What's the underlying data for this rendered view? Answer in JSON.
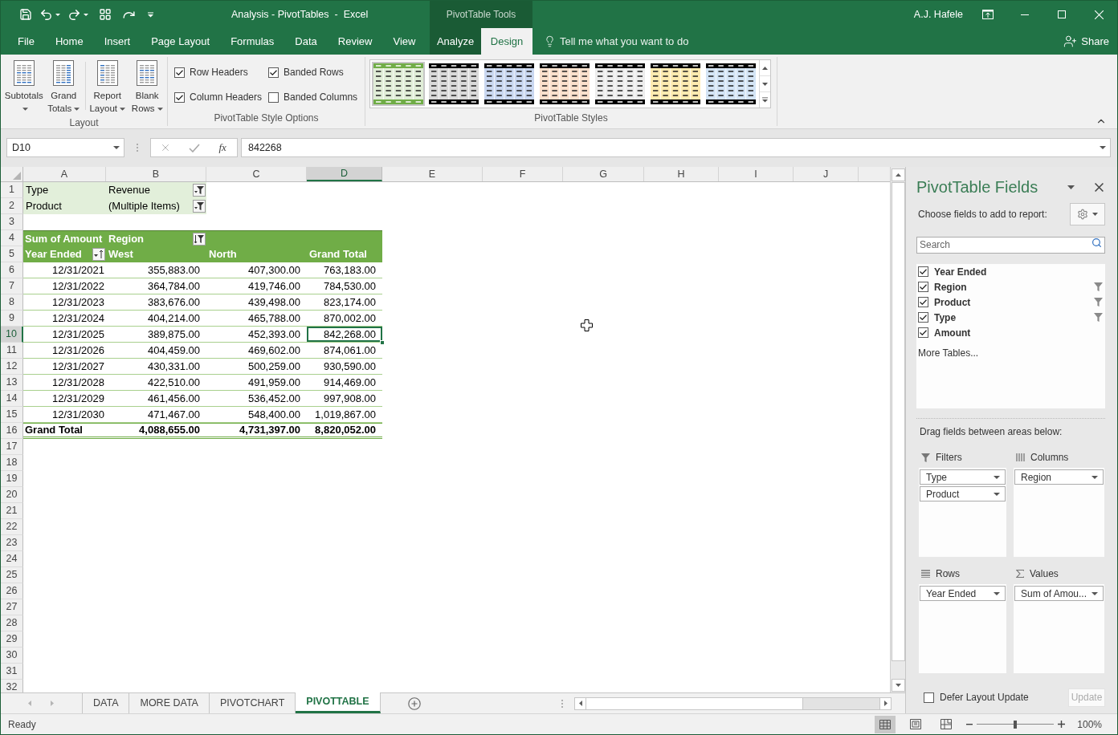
{
  "title_bar": {
    "title": "Analysis - PivotTables  -  Excel",
    "context_group": "PivotTable Tools",
    "user": "A.J. Hafele"
  },
  "ribbon_tabs": [
    {
      "label": "File",
      "kind": "standard",
      "selected": false
    },
    {
      "label": "Home",
      "kind": "standard",
      "selected": false
    },
    {
      "label": "Insert",
      "kind": "standard",
      "selected": false
    },
    {
      "label": "Page Layout",
      "kind": "standard",
      "selected": false
    },
    {
      "label": "Formulas",
      "kind": "standard",
      "selected": false
    },
    {
      "label": "Data",
      "kind": "standard",
      "selected": false
    },
    {
      "label": "Review",
      "kind": "standard",
      "selected": false
    },
    {
      "label": "View",
      "kind": "standard",
      "selected": false
    },
    {
      "label": "Analyze",
      "kind": "contextual",
      "selected": false
    },
    {
      "label": "Design",
      "kind": "contextual",
      "selected": true
    }
  ],
  "tell_me": "Tell me what you want to do",
  "share": "Share",
  "ribbon": {
    "layout": {
      "title": "Layout",
      "buttons": [
        {
          "label": "Subtotals"
        },
        {
          "label": "Grand Totals"
        },
        {
          "label": "Report Layout"
        },
        {
          "label": "Blank Rows"
        }
      ]
    },
    "style_options": {
      "title": "PivotTable Style Options",
      "options": [
        {
          "label": "Row Headers",
          "checked": true
        },
        {
          "label": "Banded Rows",
          "checked": true
        },
        {
          "label": "Column Headers",
          "checked": true
        },
        {
          "label": "Banded Columns",
          "checked": false
        }
      ]
    },
    "styles": {
      "title": "PivotTable Styles",
      "items": [
        {
          "kind": "accent",
          "color": "#70ad47",
          "selected": true
        },
        {
          "kind": "dark",
          "color": "#d9d9d9",
          "selected": false
        },
        {
          "kind": "dark",
          "color": "#c9d7f0",
          "selected": false
        },
        {
          "kind": "dark",
          "color": "#fbe0cc",
          "selected": false
        },
        {
          "kind": "dark",
          "color": "#ededed",
          "selected": false
        },
        {
          "kind": "dark",
          "color": "#ffebb0",
          "selected": false
        },
        {
          "kind": "dark",
          "color": "#d3e4f5",
          "selected": false
        }
      ]
    }
  },
  "formula_bar": {
    "name_box": "D10",
    "function_label": "fx",
    "value": "842268"
  },
  "sheet": {
    "columns": [
      {
        "label": "A",
        "selected": false
      },
      {
        "label": "B",
        "selected": false
      },
      {
        "label": "C",
        "selected": false
      },
      {
        "label": "D",
        "selected": true
      },
      {
        "label": "E",
        "selected": false
      },
      {
        "label": "F",
        "selected": false
      },
      {
        "label": "G",
        "selected": false
      },
      {
        "label": "H",
        "selected": false
      },
      {
        "label": "I",
        "selected": false
      },
      {
        "label": "J",
        "selected": false
      }
    ],
    "rows": [
      {
        "label": "1",
        "selected": false
      },
      {
        "label": "2",
        "selected": false
      },
      {
        "label": "3",
        "selected": false
      },
      {
        "label": "4",
        "selected": false
      },
      {
        "label": "5",
        "selected": false
      },
      {
        "label": "6",
        "selected": false
      },
      {
        "label": "7",
        "selected": false
      },
      {
        "label": "8",
        "selected": false
      },
      {
        "label": "9",
        "selected": false
      },
      {
        "label": "10",
        "selected": true
      },
      {
        "label": "11",
        "selected": false
      },
      {
        "label": "12",
        "selected": false
      },
      {
        "label": "13",
        "selected": false
      },
      {
        "label": "14",
        "selected": false
      },
      {
        "label": "15",
        "selected": false
      },
      {
        "label": "16",
        "selected": false
      },
      {
        "label": "17",
        "selected": false
      },
      {
        "label": "18",
        "selected": false
      },
      {
        "label": "19",
        "selected": false
      },
      {
        "label": "20",
        "selected": false
      },
      {
        "label": "21",
        "selected": false
      },
      {
        "label": "22",
        "selected": false
      },
      {
        "label": "23",
        "selected": false
      },
      {
        "label": "24",
        "selected": false
      },
      {
        "label": "25",
        "selected": false
      },
      {
        "label": "26",
        "selected": false
      },
      {
        "label": "27",
        "selected": false
      },
      {
        "label": "28",
        "selected": false
      },
      {
        "label": "29",
        "selected": false
      },
      {
        "label": "30",
        "selected": false
      },
      {
        "label": "31",
        "selected": false
      },
      {
        "label": "32",
        "selected": false
      }
    ],
    "report_filters": [
      {
        "field": "Type",
        "value": "Revenue"
      },
      {
        "field": "Product",
        "value": "(Multiple Items)"
      }
    ],
    "pivot": {
      "values_label": "Sum of Amount",
      "column_field": "Region",
      "row_field": "Year Ended",
      "column_items": [
        "West",
        "North",
        "Grand Total"
      ],
      "rows": [
        {
          "label": "12/31/2021",
          "cells": [
            {
              "text": "355,883.00",
              "selected": false
            },
            {
              "text": "407,300.00",
              "selected": false
            },
            {
              "text": "763,183.00",
              "selected": false
            }
          ]
        },
        {
          "label": "12/31/2022",
          "cells": [
            {
              "text": "364,784.00",
              "selected": false
            },
            {
              "text": "419,746.00",
              "selected": false
            },
            {
              "text": "784,530.00",
              "selected": false
            }
          ]
        },
        {
          "label": "12/31/2023",
          "cells": [
            {
              "text": "383,676.00",
              "selected": false
            },
            {
              "text": "439,498.00",
              "selected": false
            },
            {
              "text": "823,174.00",
              "selected": false
            }
          ]
        },
        {
          "label": "12/31/2024",
          "cells": [
            {
              "text": "404,214.00",
              "selected": false
            },
            {
              "text": "465,788.00",
              "selected": false
            },
            {
              "text": "870,002.00",
              "selected": false
            }
          ]
        },
        {
          "label": "12/31/2025",
          "cells": [
            {
              "text": "389,875.00",
              "selected": false
            },
            {
              "text": "452,393.00",
              "selected": false
            },
            {
              "text": "842,268.00",
              "selected": true
            }
          ]
        },
        {
          "label": "12/31/2026",
          "cells": [
            {
              "text": "404,459.00",
              "selected": false
            },
            {
              "text": "469,602.00",
              "selected": false
            },
            {
              "text": "874,061.00",
              "selected": false
            }
          ]
        },
        {
          "label": "12/31/2027",
          "cells": [
            {
              "text": "430,331.00",
              "selected": false
            },
            {
              "text": "500,259.00",
              "selected": false
            },
            {
              "text": "930,590.00",
              "selected": false
            }
          ]
        },
        {
          "label": "12/31/2028",
          "cells": [
            {
              "text": "422,510.00",
              "selected": false
            },
            {
              "text": "491,959.00",
              "selected": false
            },
            {
              "text": "914,469.00",
              "selected": false
            }
          ]
        },
        {
          "label": "12/31/2029",
          "cells": [
            {
              "text": "461,456.00",
              "selected": false
            },
            {
              "text": "536,452.00",
              "selected": false
            },
            {
              "text": "997,908.00",
              "selected": false
            }
          ]
        },
        {
          "label": "12/31/2030",
          "cells": [
            {
              "text": "471,467.00",
              "selected": false
            },
            {
              "text": "548,400.00",
              "selected": false
            },
            {
              "text": "1,019,867.00",
              "selected": false
            }
          ]
        }
      ],
      "grand_total": {
        "label": "Grand Total",
        "values": [
          "4,088,655.00",
          "4,731,397.00",
          "8,820,052.00"
        ]
      }
    }
  },
  "sheet_tabs": [
    {
      "label": "DATA",
      "selected": false
    },
    {
      "label": "MORE DATA",
      "selected": false
    },
    {
      "label": "PIVOTCHART",
      "selected": false
    },
    {
      "label": "PIVOTTABLE",
      "selected": true
    }
  ],
  "field_list": {
    "title": "PivotTable Fields",
    "prompt": "Choose fields to add to report:",
    "search": {
      "placeholder": "Search"
    },
    "fields": [
      {
        "label": "Year Ended",
        "checked": true,
        "filtered": false
      },
      {
        "label": "Region",
        "checked": true,
        "filtered": true
      },
      {
        "label": "Product",
        "checked": true,
        "filtered": true
      },
      {
        "label": "Type",
        "checked": true,
        "filtered": true
      },
      {
        "label": "Amount",
        "checked": true,
        "filtered": false
      }
    ],
    "more_tables": "More Tables...",
    "areas_hint": "Drag fields between areas below:",
    "areas": [
      {
        "kind": "filters",
        "label": "Filters",
        "fields": [
          "Type",
          "Product"
        ]
      },
      {
        "kind": "columns",
        "label": "Columns",
        "fields": [
          "Region"
        ]
      },
      {
        "kind": "rows",
        "label": "Rows",
        "fields": [
          "Year Ended"
        ]
      },
      {
        "kind": "values",
        "label": "Values",
        "fields": [
          "Sum of Amou..."
        ]
      }
    ],
    "defer_update": {
      "label": "Defer Layout Update",
      "checked": false
    },
    "update_button": {
      "label": "Update",
      "disabled": true
    }
  },
  "status_bar": {
    "status": "Ready",
    "views": [
      {
        "selected": true
      },
      {
        "selected": false
      },
      {
        "selected": false
      }
    ],
    "zoom": {
      "level": 0.5,
      "label": "100%"
    }
  }
}
